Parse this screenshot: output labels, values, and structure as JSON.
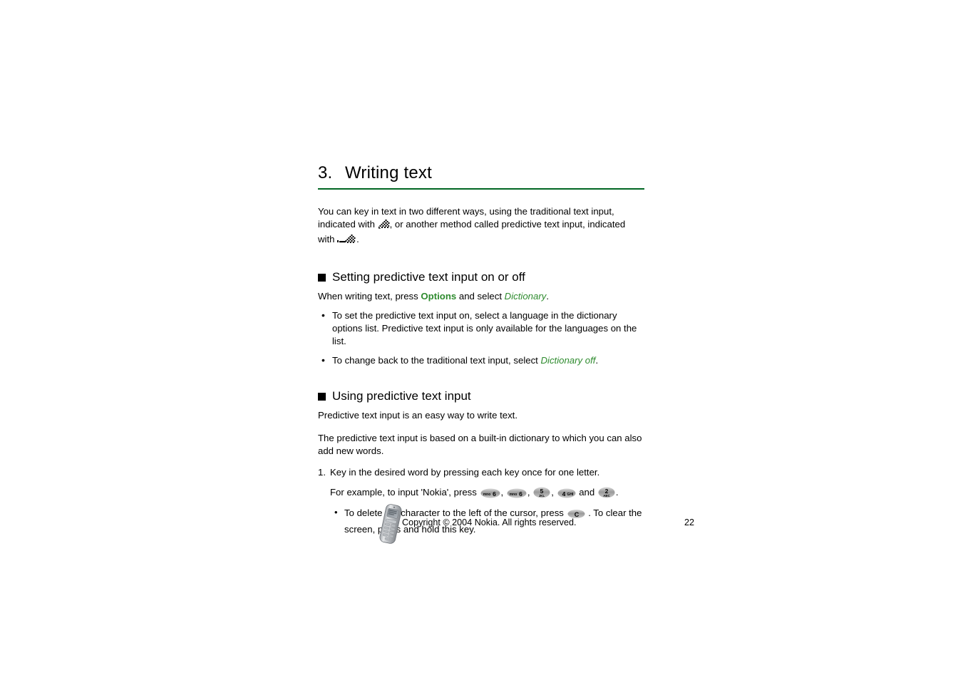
{
  "document": {
    "chapter_number": "3.",
    "chapter_title": "Writing text",
    "rule_color": "#006622",
    "accent_green": "#2e8b2e"
  },
  "intro": {
    "part1": "You can key in text in two different ways, using the traditional text input, indicated with ",
    "icon1_name": "traditional-text-input-icon",
    "part2": ", or another method called predictive text input, indicated with ",
    "icon2_name": "predictive-text-input-icon",
    "part3": "."
  },
  "sections": [
    {
      "marker": "square-bullet",
      "heading": "Setting predictive text input on or off",
      "lead": {
        "part1": "When writing text, press ",
        "emphasis_bold": "Options",
        "part2": " and select ",
        "emphasis_italic": "Dictionary",
        "part3": "."
      },
      "bullets": [
        {
          "part1": "To set the predictive text input on, select a language in the dictionary options list. Predictive text input is only available for the languages on the list."
        },
        {
          "part1": "To change back to the traditional text input, select ",
          "emphasis_italic": "Dictionary off",
          "part2": "."
        }
      ]
    },
    {
      "marker": "square-bullet",
      "heading": "Using predictive text input",
      "paragraphs": [
        "Predictive text input is an easy way to write text.",
        "The predictive text input is based on a built-in dictionary to which you can also add new words."
      ],
      "numbered": [
        {
          "number": "1.",
          "text": "Key in the desired word by pressing each key once for one letter.",
          "example": {
            "part1": "For example, to input 'Nokia', press ",
            "keys": [
              {
                "digit": "6",
                "letters": "mno"
              },
              {
                "digit": "6",
                "letters": "mno"
              },
              {
                "digit": "5",
                "letters": "JKL"
              },
              {
                "digit": "4",
                "letters": "GHI"
              },
              {
                "digit": "2",
                "letters": "ABC"
              }
            ],
            "separator": ", ",
            "conjunction": " and ",
            "terminator": "."
          },
          "subbullets": [
            {
              "part1": "To delete the character to the left of the cursor, press ",
              "key": {
                "digit": "C",
                "letters": ""
              },
              "part2": " . To clear the screen, press and hold this key."
            }
          ]
        }
      ]
    }
  ],
  "footer": {
    "phone_icon_name": "nokia-phone-image",
    "copyright": "Copyright © 2004 Nokia. All rights reserved.",
    "page_number": "22"
  }
}
